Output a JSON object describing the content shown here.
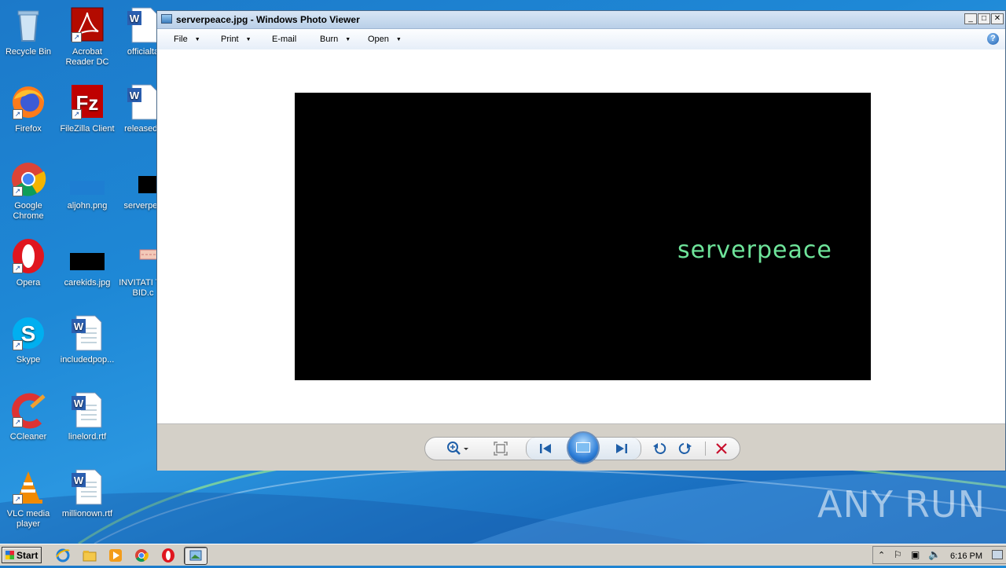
{
  "desktop": {
    "icons": [
      {
        "label": "Recycle Bin"
      },
      {
        "label": "Acrobat Reader DC"
      },
      {
        "label": "officialta"
      },
      {
        "label": "Firefox"
      },
      {
        "label": "FileZilla Client"
      },
      {
        "label": "releasedc"
      },
      {
        "label": "Google Chrome"
      },
      {
        "label": "aljohn.png"
      },
      {
        "label": "serverpea"
      },
      {
        "label": "Opera"
      },
      {
        "label": "carekids.jpg"
      },
      {
        "label": "INVITATI TO BID.c"
      },
      {
        "label": "Skype"
      },
      {
        "label": "includedpop..."
      },
      {
        "label": "CCleaner"
      },
      {
        "label": "linelord.rtf"
      },
      {
        "label": "VLC media player"
      },
      {
        "label": "millionown.rtf"
      }
    ]
  },
  "window": {
    "title": "serverpeace.jpg - Windows Photo Viewer",
    "menu": [
      {
        "label": "File"
      },
      {
        "label": "Print"
      },
      {
        "label": "E-mail"
      },
      {
        "label": "Burn"
      },
      {
        "label": "Open"
      }
    ],
    "help_label": "?",
    "photo_text": "serverpeace",
    "photo_text_color": "#6ee49a"
  },
  "watermark": {
    "left": "ANY",
    "right": "RUN"
  },
  "taskbar": {
    "start_label": "Start",
    "clock": "6:16 PM"
  }
}
